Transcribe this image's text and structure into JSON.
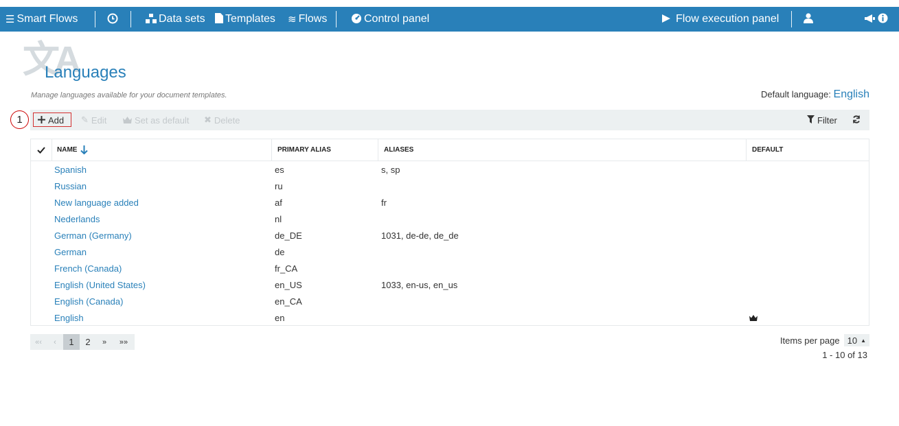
{
  "nav": {
    "brand": "Smart Flows",
    "datasets": "Data sets",
    "templates": "Templates",
    "flows": "Flows",
    "control_panel": "Control panel",
    "execution_panel": "Flow execution panel"
  },
  "page": {
    "title": "Languages",
    "subtitle": "Manage languages available for your document templates.",
    "default_language_label": "Default language:",
    "default_language_value": "English"
  },
  "toolbar": {
    "step": "1",
    "add": "Add",
    "edit": "Edit",
    "set_default": "Set as default",
    "delete": "Delete",
    "filter": "Filter"
  },
  "table": {
    "columns": [
      "Name",
      "Primary alias",
      "Aliases",
      "Default"
    ],
    "rows": [
      {
        "name": "Spanish",
        "primary": "es",
        "aliases": "s, sp",
        "default": ""
      },
      {
        "name": "Russian",
        "primary": "ru",
        "aliases": "",
        "default": ""
      },
      {
        "name": "New language added",
        "primary": "af",
        "aliases": "fr",
        "default": ""
      },
      {
        "name": "Nederlands",
        "primary": "nl",
        "aliases": "",
        "default": ""
      },
      {
        "name": "German (Germany)",
        "primary": "de_DE",
        "aliases": "1031, de-de, de_de",
        "default": ""
      },
      {
        "name": "German",
        "primary": "de",
        "aliases": "",
        "default": ""
      },
      {
        "name": "French (Canada)",
        "primary": "fr_CA",
        "aliases": "",
        "default": ""
      },
      {
        "name": "English (United States)",
        "primary": "en_US",
        "aliases": "1033, en-us, en_us",
        "default": ""
      },
      {
        "name": "English (Canada)",
        "primary": "en_CA",
        "aliases": "",
        "default": ""
      },
      {
        "name": "English",
        "primary": "en",
        "aliases": "",
        "default": "crown-icon"
      }
    ]
  },
  "pager": {
    "first": "«‹",
    "prev": "‹",
    "pages": [
      "1",
      "2"
    ],
    "next": "»",
    "last": "»»",
    "items_per_page_label": "Items per page",
    "items_per_page_value": "10",
    "range": "1 - 10 of 13"
  },
  "colors": {
    "brand": "#2980b9",
    "toolbar_bg": "#ecf0f1",
    "highlight": "#d32f2f"
  }
}
